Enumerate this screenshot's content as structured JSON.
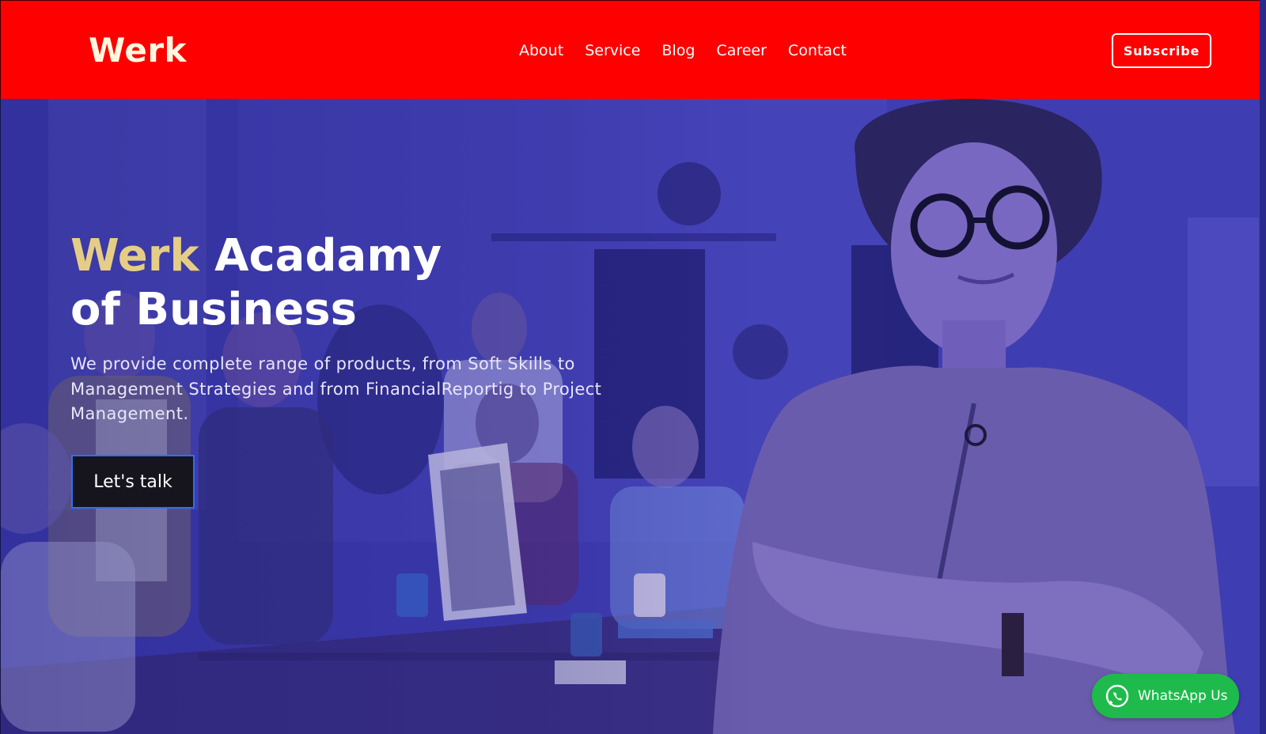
{
  "header": {
    "logo": "Werk",
    "nav": [
      "About",
      "Service",
      "Blog",
      "Career",
      "Contact"
    ],
    "subscribe_label": "Subscribe"
  },
  "hero": {
    "title_accent": "Werk",
    "title_rest": " Acadamy",
    "title_line2": "of Business",
    "description": "We provide complete range of products, from Soft Skills to Management Strategies and from FinancialReportig to Project Management.",
    "cta_label": "Let's talk",
    "background_image": "team-meeting-woman-arms-crossed-photo"
  },
  "floating": {
    "whatsapp_label": "WhatsApp Us",
    "whatsapp_icon": "whatsapp-icon"
  },
  "colors": {
    "header_bg": "#ff0000",
    "hero_tint": "#3d3bb0",
    "accent_gold": "#e5cd86",
    "cta_bg": "#16151d",
    "cta_border": "#2f6ff0",
    "whatsapp_green": "#1fba4c"
  }
}
